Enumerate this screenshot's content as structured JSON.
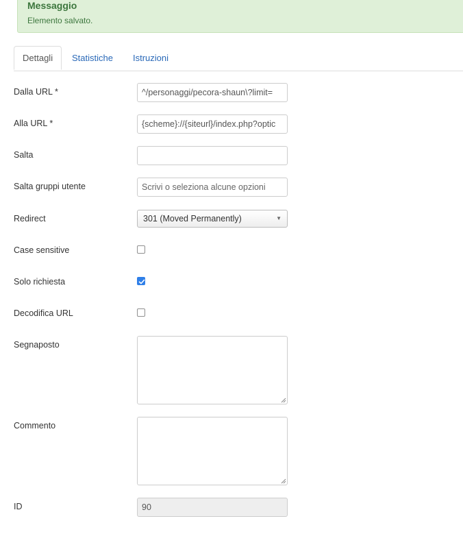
{
  "alert": {
    "title": "Messaggio",
    "message": "Elemento salvato."
  },
  "tabs": [
    {
      "label": "Dettagli",
      "active": true
    },
    {
      "label": "Statistiche",
      "active": false
    },
    {
      "label": "Istruzioni",
      "active": false
    }
  ],
  "form": {
    "from_url": {
      "label": "Dalla URL *",
      "value": "^/personaggi/pecora-shaun\\?limit="
    },
    "to_url": {
      "label": "Alla URL *",
      "value": "{scheme}://{siteurl}/index.php?optic"
    },
    "skip": {
      "label": "Salta",
      "value": ""
    },
    "skip_groups": {
      "label": "Salta gruppi utente",
      "placeholder": "Scrivi o seleziona alcune opzioni"
    },
    "redirect": {
      "label": "Redirect",
      "value": "301 (Moved Permanently)"
    },
    "case_sensitive": {
      "label": "Case sensitive",
      "checked": false
    },
    "request_only": {
      "label": "Solo richiesta",
      "checked": true
    },
    "decode_url": {
      "label": "Decodifica URL",
      "checked": false
    },
    "placeholder": {
      "label": "Segnaposto",
      "value": ""
    },
    "comment": {
      "label": "Commento",
      "value": ""
    },
    "id": {
      "label": "ID",
      "value": "90"
    }
  },
  "colors": {
    "alert_bg": "#dff0d8",
    "alert_text": "#3c763d",
    "link": "#2a69b8",
    "checkbox_checked": "#2f7fe8"
  }
}
